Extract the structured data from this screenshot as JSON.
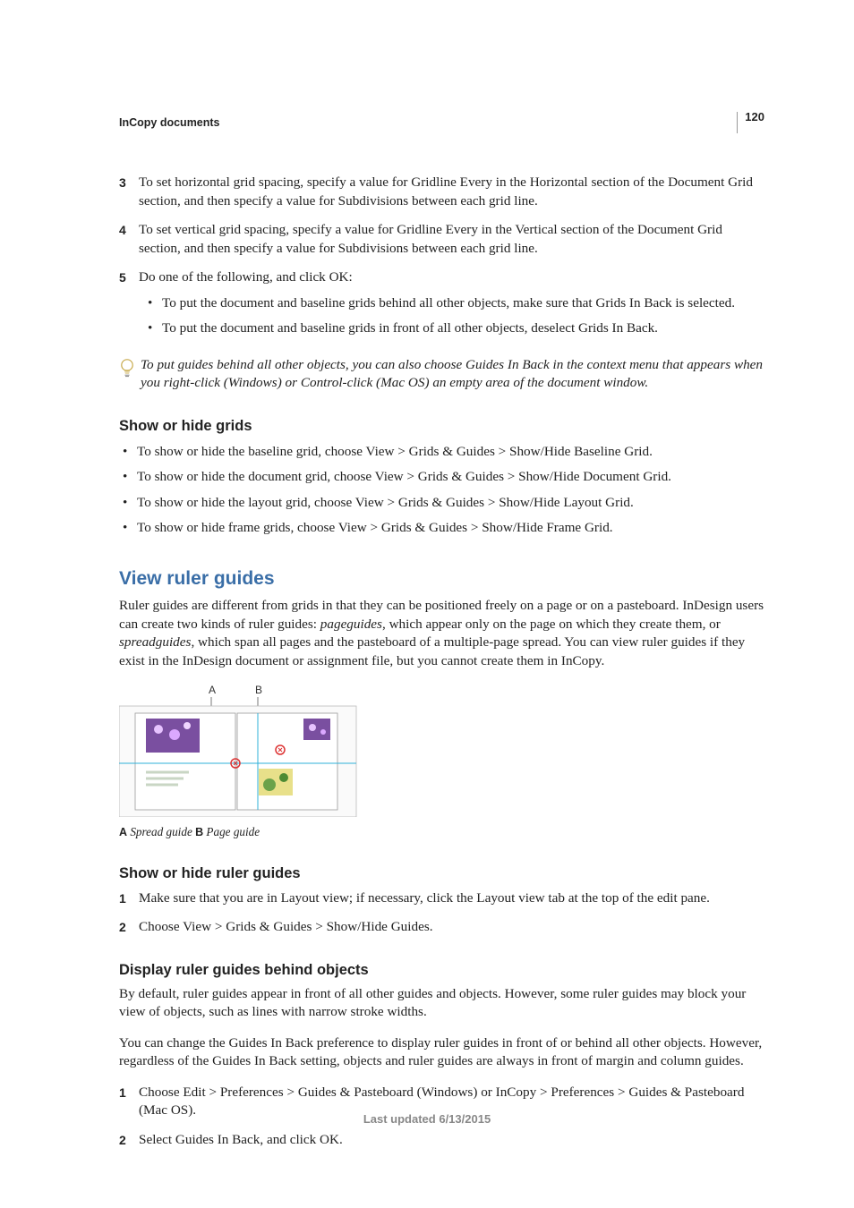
{
  "page_number": "120",
  "header": "InCopy documents",
  "steps_a": [
    {
      "n": "3",
      "text": "To set horizontal grid spacing, specify a value for Gridline Every in the Horizontal section of the Document Grid section, and then specify a value for Subdivisions between each grid line."
    },
    {
      "n": "4",
      "text": "To set vertical grid spacing, specify a value for Gridline Every in the Vertical section of the Document Grid section, and then specify a value for Subdivisions between each grid line."
    },
    {
      "n": "5",
      "text": "Do one of the following, and click OK:"
    }
  ],
  "steps_a_sub": [
    "To put the document and baseline grids behind all other objects, make sure that Grids In Back is selected.",
    "To put the document and baseline grids in front of all other objects, deselect Grids In Back."
  ],
  "tip": "To put guides behind all other objects, you can also choose Guides In Back in the context menu that appears when you right-click (Windows) or Control-click (Mac OS) an empty area of the document window.",
  "section_show_hide_grids": {
    "title": "Show or hide grids",
    "items": [
      "To show or hide the baseline grid, choose View > Grids & Guides > Show/Hide Baseline Grid.",
      "To show or hide the document grid, choose View > Grids & Guides > Show/Hide Document Grid.",
      "To show or hide the layout grid, choose View > Grids & Guides > Show/Hide Layout Grid.",
      "To show or hide frame grids, choose View > Grids & Guides > Show/Hide Frame Grid."
    ]
  },
  "section_view_ruler": {
    "title": "View ruler guides",
    "intro_pre": "Ruler guides are different from grids in that they can be positioned freely on a page or on a pasteboard. InDesign users can create two kinds of ruler guides: ",
    "intro_em1": "pageguides",
    "intro_mid": ", which appear only on the page on which they create them, or ",
    "intro_em2": "spreadguides",
    "intro_post": ", which span all pages and the pasteboard of a multiple-page spread. You can view ruler guides if they exist in the InDesign document or assignment file, but you cannot create them in InCopy."
  },
  "figure_labels": {
    "A": "A",
    "B": "B"
  },
  "caption": {
    "a_letter": "A",
    "a_text": " Spread guide  ",
    "b_letter": "B",
    "b_text": " Page guide"
  },
  "section_show_hide_ruler": {
    "title": "Show or hide ruler guides",
    "steps": [
      {
        "n": "1",
        "text": "Make sure that you are in Layout view; if necessary, click the Layout view tab at the top of the edit pane."
      },
      {
        "n": "2",
        "text": "Choose View > Grids & Guides > Show/Hide Guides."
      }
    ]
  },
  "section_display_behind": {
    "title": "Display ruler guides behind objects",
    "para1": "By default, ruler guides appear in front of all other guides and objects. However, some ruler guides may block your view of objects, such as lines with narrow stroke widths.",
    "para2": "You can change the Guides In Back preference to display ruler guides in front of or behind all other objects. However, regardless of the Guides In Back setting, objects and ruler guides are always in front of margin and column guides.",
    "steps": [
      {
        "n": "1",
        "text": "Choose Edit > Preferences > Guides & Pasteboard (Windows) or InCopy > Preferences > Guides & Pasteboard (Mac OS)."
      },
      {
        "n": "2",
        "text": "Select Guides In Back, and click OK."
      }
    ]
  },
  "footer": "Last updated 6/13/2015"
}
